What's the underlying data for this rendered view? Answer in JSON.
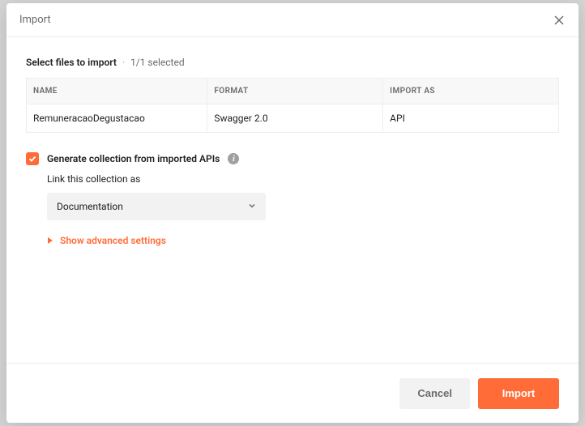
{
  "modal": {
    "title": "Import",
    "subtitle_label": "Select files to import",
    "subtitle_separator": "·",
    "subtitle_count": "1/1 selected"
  },
  "table": {
    "headers": {
      "name": "NAME",
      "format": "FORMAT",
      "import_as": "IMPORT AS"
    },
    "rows": [
      {
        "name": "RemuneracaoDegustacao",
        "format": "Swagger 2.0",
        "import_as": "API"
      }
    ]
  },
  "options": {
    "generate_label": "Generate collection from imported APIs",
    "link_label": "Link this collection as",
    "link_value": "Documentation",
    "advanced_label": "Show advanced settings"
  },
  "footer": {
    "cancel": "Cancel",
    "import": "Import"
  }
}
